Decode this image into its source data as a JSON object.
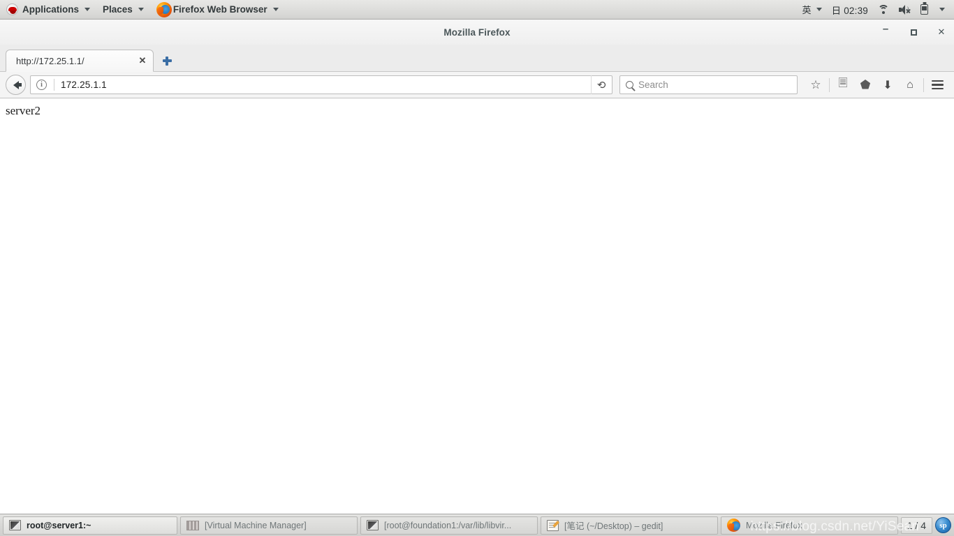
{
  "top_panel": {
    "applications_label": "Applications",
    "places_label": "Places",
    "active_app_label": "Firefox Web Browser",
    "tray": {
      "input_method": "英",
      "clock": "日 02:39",
      "icons": [
        "wifi-icon",
        "speaker-muted-icon",
        "battery-icon",
        "chevron-down-icon"
      ]
    }
  },
  "window": {
    "title": "Mozilla Firefox",
    "controls": {
      "minimize": "–",
      "maximize": "□",
      "close": "✕"
    }
  },
  "tabs": [
    {
      "title": "http://172.25.1.1/",
      "close_label": "✕"
    }
  ],
  "new_tab": {
    "label": "+"
  },
  "navbar": {
    "back_label": "Back",
    "url_value": "172.25.1.1",
    "info_glyph": "i",
    "reload_glyph": "⟳",
    "search_placeholder": "Search",
    "icons": [
      "star-icon",
      "reader-icon",
      "pocket-icon",
      "download-icon",
      "home-icon",
      "menu-icon"
    ],
    "star_glyph": "☆",
    "reader_glyph": "Ὄb",
    "pocket_glyph": "⬟",
    "download_glyph": "⬇",
    "home_glyph": "⌂"
  },
  "content": {
    "body_text": "server2"
  },
  "taskbar": {
    "items": [
      {
        "label": "root@server1:~",
        "icon": "terminal-icon",
        "active": true
      },
      {
        "label": "[Virtual Machine Manager]",
        "icon": "vmm-icon",
        "active": false
      },
      {
        "label": "[root@foundation1:/var/lib/libvir...",
        "icon": "terminal-icon",
        "active": false
      },
      {
        "label": "[笔记 (~/Desktop) – gedit]",
        "icon": "gedit-icon",
        "active": false
      },
      {
        "label": "Mozilla Firefox",
        "icon": "firefox-icon",
        "active": false
      }
    ],
    "workspace": "1 / 4",
    "tray_app_glyph": "sp"
  },
  "watermark": "https://blog.csdn.net/YiSean",
  "colors": {
    "panel_bg": "#dedede",
    "tabstrip_bg": "#ececec",
    "navbar_bg": "#f4f4f4",
    "content_bg": "#ffffff",
    "taskbar_bg": "#d8d8d6",
    "accent_blue": "#3b6ea5"
  }
}
